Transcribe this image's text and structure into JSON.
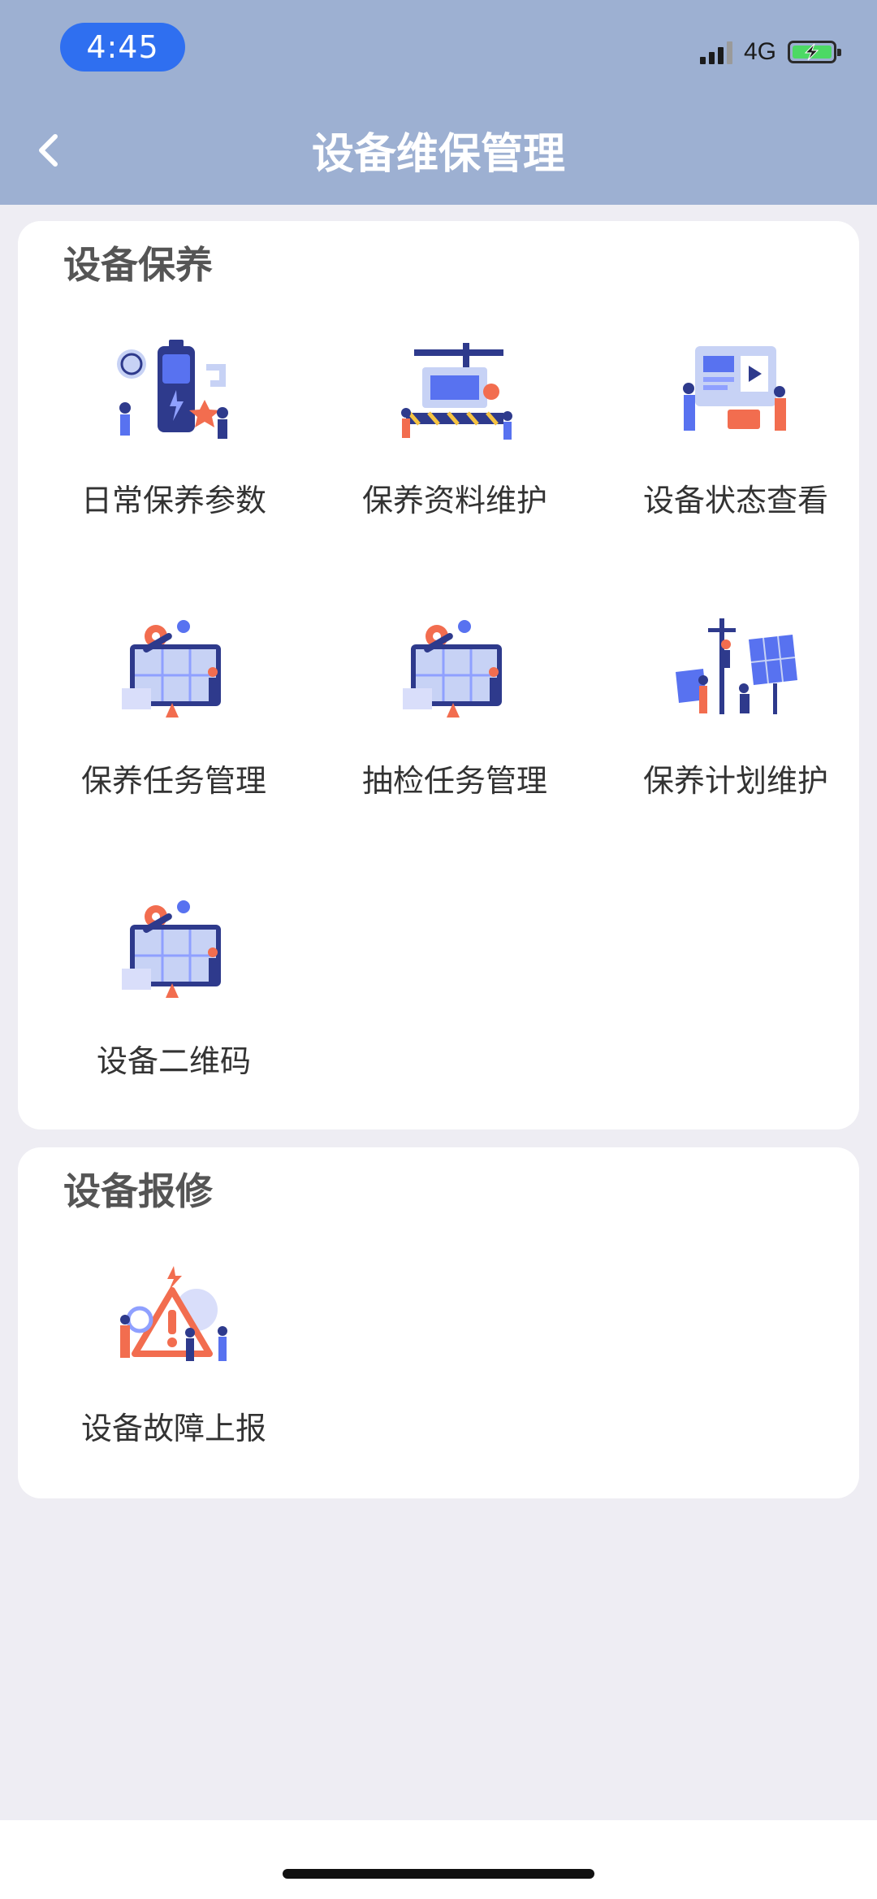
{
  "status_bar": {
    "time": "4:45",
    "network": "4G",
    "battery_charging": true,
    "colors": {
      "pill": "#2f6ff0",
      "battery": "#4cd964"
    }
  },
  "header": {
    "title": "设备维保管理",
    "back_icon": "chevron-left-icon",
    "background": "#9db0d2"
  },
  "sections": [
    {
      "title": "设备保养",
      "items": [
        {
          "label": "日常保养参数",
          "icon": "battery-maintenance-illustration"
        },
        {
          "label": "保养资料维护",
          "icon": "construction-crane-illustration"
        },
        {
          "label": "设备状态查看",
          "icon": "status-board-illustration"
        },
        {
          "label": "保养任务管理",
          "icon": "gear-wrench-monitor-illustration"
        },
        {
          "label": "抽检任务管理",
          "icon": "gear-wrench-monitor-illustration"
        },
        {
          "label": "保养计划维护",
          "icon": "solar-panel-illustration"
        },
        {
          "label": "设备二维码",
          "icon": "gear-wrench-monitor-illustration"
        }
      ]
    },
    {
      "title": "设备报修",
      "items": [
        {
          "label": "设备故障上报",
          "icon": "warning-alert-illustration"
        }
      ]
    }
  ]
}
